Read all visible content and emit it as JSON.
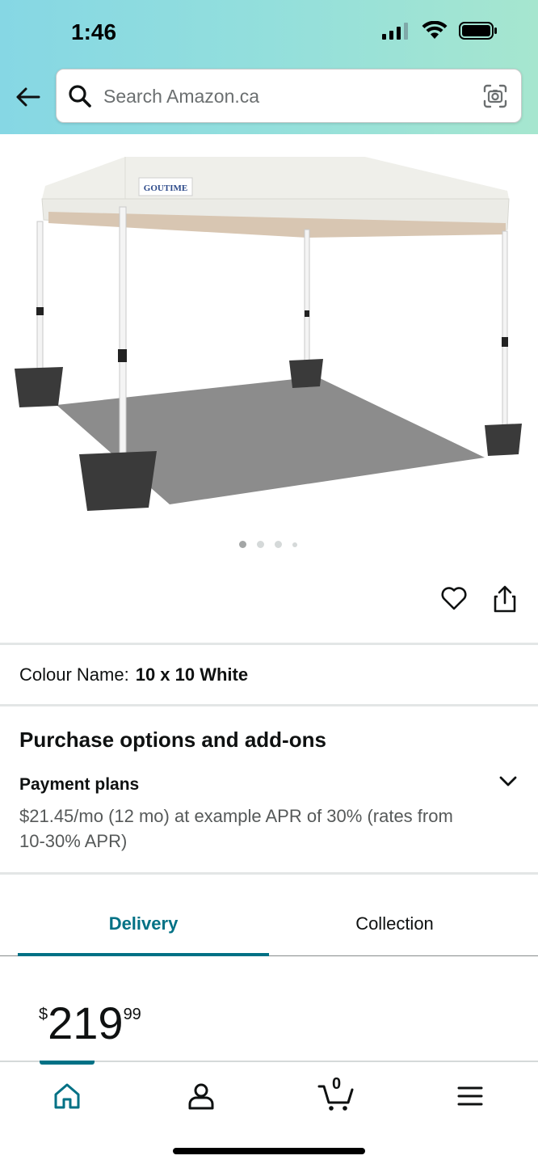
{
  "status_bar": {
    "time": "1:46"
  },
  "search": {
    "placeholder": "Search Amazon.ca"
  },
  "product": {
    "brand_logo_text": "GOUTIME",
    "image_count": 4,
    "active_image_index": 1
  },
  "colour": {
    "label": "Colour Name:",
    "value": "10 x 10 White"
  },
  "purchase_options": {
    "title": "Purchase options and add-ons",
    "payment_plans_title": "Payment plans",
    "payment_plans_text": "$21.45/mo (12 mo) at example APR of 30% (rates from 10-30% APR)"
  },
  "tabs": [
    {
      "label": "Delivery",
      "active": true
    },
    {
      "label": "Collection",
      "active": false
    }
  ],
  "price": {
    "symbol": "$",
    "whole": "219",
    "fraction": "99"
  },
  "bottom_nav": {
    "cart_count": "0",
    "active_item": "home",
    "items": [
      "home-icon",
      "account-icon",
      "cart-icon",
      "menu-icon"
    ]
  },
  "colors": {
    "accent_teal": "#007185",
    "header_gradient_start": "#86d7e4",
    "header_gradient_end": "#a6e6cf",
    "text_primary": "#0f1111",
    "text_secondary": "#565959"
  }
}
